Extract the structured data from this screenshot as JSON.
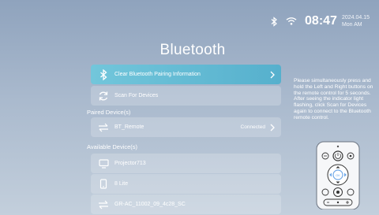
{
  "status_bar": {
    "icons": [
      "bluetooth-icon",
      "wifi-icon"
    ],
    "time": "08:47",
    "date": "2024.04.15",
    "weekday_ampm": "Mon AM"
  },
  "page_title": "Bluetooth",
  "actions": [
    {
      "label": "Clear Bluetooth Pairing Information",
      "icon": "bluetooth-icon",
      "focused": true
    },
    {
      "label": "Scan For Devices",
      "icon": "refresh-icon",
      "focused": false
    }
  ],
  "paired": {
    "heading": "Paired Device(s)",
    "devices": [
      {
        "name": "BT_Remote",
        "icon": "transfer-arrows-icon",
        "status": "Connected"
      }
    ]
  },
  "available": {
    "heading": "Available Device(s)",
    "devices": [
      {
        "name": "Projector713",
        "icon": "monitor-icon"
      },
      {
        "name": "8 Lite",
        "icon": "phone-icon"
      },
      {
        "name": "GR-AC_11002_09_4c28_SC",
        "icon": "transfer-arrows-icon"
      }
    ]
  },
  "help_text": "Please simultaneously press and hold the Left and Right buttons on the remote control for 5 seconds. After seeing the indicator light flashing, click Scan for Devices again to connect to the Bluetooth remote control.",
  "colors": {
    "background_top": "#8fa3bd",
    "background_bottom": "#c3cfdc",
    "focus_accent": "#5fb8d2",
    "remote_highlight": "#6fa8e8"
  }
}
